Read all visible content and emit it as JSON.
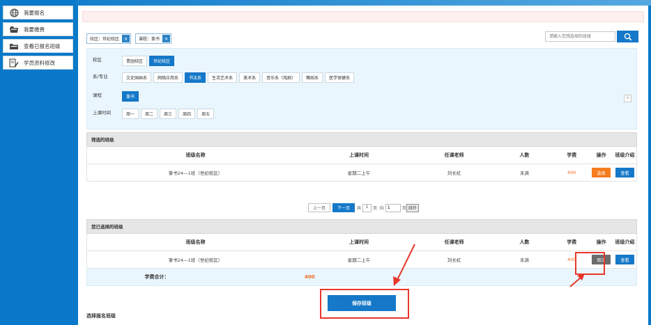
{
  "sidebar": {
    "items": [
      {
        "label": "我要报名",
        "icon": "globe-icon"
      },
      {
        "label": "我要缴费",
        "icon": "briefcase-icon"
      },
      {
        "label": "查看已报名班级",
        "icon": "folder-icon"
      },
      {
        "label": "学员资料修改",
        "icon": "edit-icon"
      }
    ]
  },
  "chips": [
    {
      "label": "校区：世纪校区",
      "close": "×"
    },
    {
      "label": "课程：篆书",
      "close": "×"
    }
  ],
  "search": {
    "placeholder": "请输入您想选择的班级"
  },
  "filter": {
    "campus": {
      "label": "校区",
      "options": [
        "青园校区",
        "世纪校区"
      ],
      "selected": "世纪校区"
    },
    "department": {
      "label": "系/专业",
      "options": [
        "文史国画系",
        "网络应用系",
        "书法系",
        "生活艺术系",
        "美术系",
        "音乐系（戏剧）",
        "舞蹈系",
        "医学保健系"
      ],
      "selected": "书法系"
    },
    "course": {
      "label": "课程",
      "options": [
        "篆书"
      ],
      "selected": "篆书"
    },
    "time": {
      "label": "上课时间",
      "options": [
        "周一",
        "周二",
        "周三",
        "周四",
        "周五"
      ]
    },
    "plus": "+"
  },
  "columns": [
    "班级名称",
    "上课时间",
    "任课老师",
    "人数",
    "学费",
    "操作",
    "班级介绍"
  ],
  "filtered": {
    "title": "筛选的班级",
    "rows": [
      {
        "name": "篆书24—1班（世纪校区）",
        "time": "星期二上午",
        "teacher": "刘长虹",
        "count": "未满",
        "fee": "400",
        "action": "选择",
        "intro": "查看"
      }
    ]
  },
  "pager": {
    "prev": "上一页",
    "next": "下一页",
    "total_prefix": "共",
    "page": "1",
    "page_suffix": "页 ·向",
    "goto_value": "1",
    "goto_suffix": "页",
    "go": "跳转"
  },
  "selected": {
    "title": "您已选择的班级",
    "rows": [
      {
        "name": "篆书24—1班（世纪校区）",
        "time": "星期二上午",
        "teacher": "刘长虹",
        "count": "未满",
        "fee": "400",
        "action": "取消",
        "intro": "查看"
      }
    ],
    "total_label": "学费合计：",
    "total_value": "400"
  },
  "save_label": "保存班级",
  "bottom_title": "选择报名班级",
  "colors": {
    "primary": "#1578c8",
    "accent": "#f57c1f",
    "highlight": "#e8362a"
  }
}
